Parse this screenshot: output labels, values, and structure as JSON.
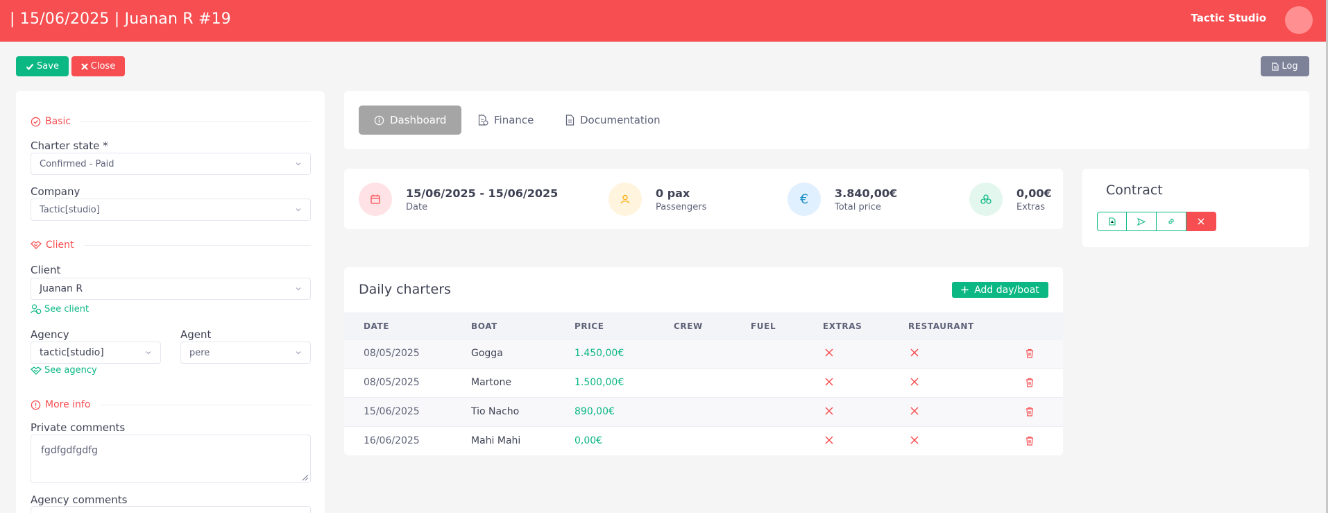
{
  "header": {
    "title": "| 15/06/2025 | Juanan R #19",
    "user_name": "Tactic Studio"
  },
  "actions": {
    "save_label": "Save",
    "close_label": "Close",
    "log_label": "Log"
  },
  "form": {
    "basic_section": "Basic",
    "charter_state_label": "Charter state *",
    "charter_state_value": "Confirmed - Paid",
    "company_label": "Company",
    "company_value": "Tactic[studio]",
    "client_section": "Client",
    "client_label": "Client",
    "client_value": "Juanan R",
    "see_client": "See client",
    "agency_label": "Agency",
    "agency_value": "tactic[studio]",
    "agent_label": "Agent",
    "agent_value": "pere",
    "see_agency": "See agency",
    "more_info_section": "More info",
    "private_comments_label": "Private comments",
    "private_comments_value": "fgdfgdfgdfg",
    "agency_comments_label": "Agency comments"
  },
  "tabs": [
    {
      "label": "Dashboard",
      "icon": "info-icon",
      "active": true
    },
    {
      "label": "Finance",
      "icon": "finance-icon",
      "active": false
    },
    {
      "label": "Documentation",
      "icon": "document-icon",
      "active": false
    }
  ],
  "stats": [
    {
      "value": "15/06/2025 - 15/06/2025",
      "label": "Date",
      "icon": "calendar-icon",
      "color": "#f64e51"
    },
    {
      "value": "0 pax",
      "label": "Passengers",
      "icon": "user-icon",
      "color": "#ffa800"
    },
    {
      "value": "3.840,00€",
      "label": "Total price",
      "icon": "euro-icon",
      "color": "#1e90c8"
    },
    {
      "value": "0,00€",
      "label": "Extras",
      "icon": "extras-icon",
      "color": "#0bb783"
    }
  ],
  "contract": {
    "title": "Contract"
  },
  "daily": {
    "title": "Daily charters",
    "add_label": "Add day/boat",
    "columns": [
      "DATE",
      "BOAT",
      "PRICE",
      "CREW",
      "FUEL",
      "EXTRAS",
      "RESTAURANT"
    ],
    "rows": [
      {
        "date": "08/05/2025",
        "boat": "Gogga",
        "price": "1.450,00€",
        "crew": "",
        "fuel": ""
      },
      {
        "date": "08/05/2025",
        "boat": "Martone",
        "price": "1.500,00€",
        "crew": "",
        "fuel": ""
      },
      {
        "date": "15/06/2025",
        "boat": "Tio Nacho",
        "price": "890,00€",
        "crew": "",
        "fuel": ""
      },
      {
        "date": "16/06/2025",
        "boat": "Mahi Mahi",
        "price": "0,00€",
        "crew": "",
        "fuel": ""
      }
    ]
  },
  "colors": {
    "brand": "#f64e51",
    "success": "#0bb783",
    "muted": "#7e8299"
  }
}
